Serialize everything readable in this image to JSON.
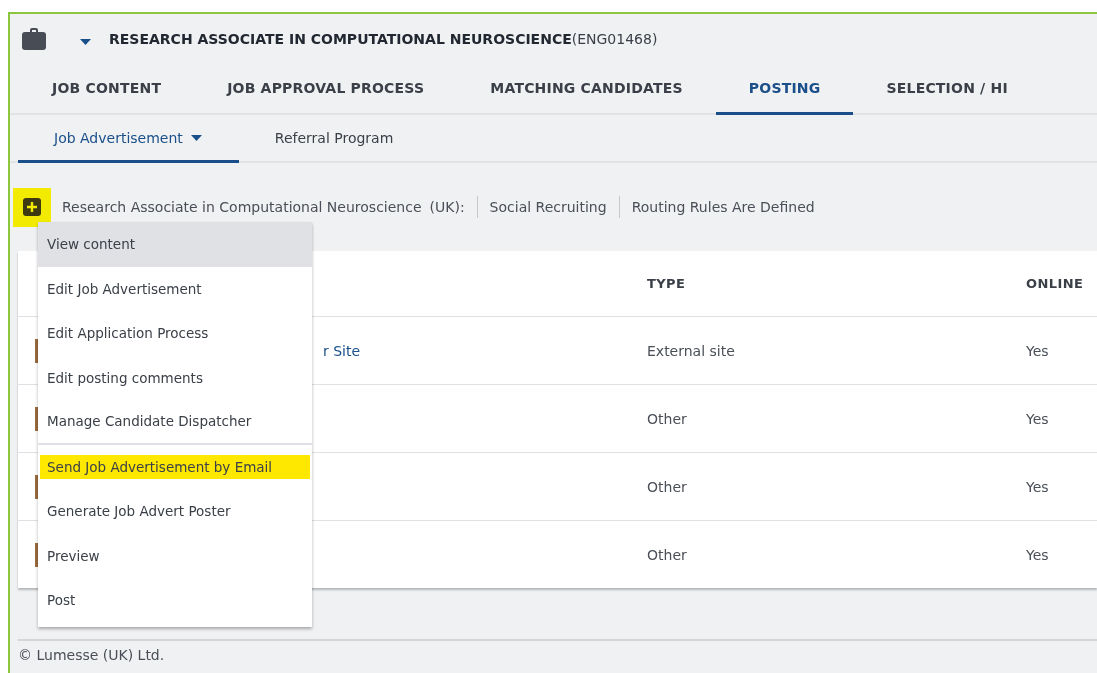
{
  "header": {
    "title": "RESEARCH ASSOCIATE IN COMPUTATIONAL NEUROSCIENCE",
    "code": "(ENG01468)"
  },
  "tabs": [
    {
      "label": "JOB CONTENT",
      "selected": false
    },
    {
      "label": "JOB APPROVAL PROCESS",
      "selected": false
    },
    {
      "label": "MATCHING CANDIDATES",
      "selected": false
    },
    {
      "label": "POSTING",
      "selected": true
    },
    {
      "label": "SELECTION / HI",
      "selected": false
    }
  ],
  "subtabs": [
    {
      "label": "Job Advertisement",
      "selected": true,
      "dropdown": true
    },
    {
      "label": "Referral Program",
      "selected": false,
      "dropdown": false
    }
  ],
  "info_bar": {
    "add_highlighted": true,
    "title": "Research Associate in Computational Neuroscience",
    "country": "(UK):",
    "items": [
      "Social Recruiting",
      "Routing Rules Are Defined"
    ]
  },
  "table": {
    "columns": [
      "TYPE",
      "ONLINE"
    ],
    "rows": [
      {
        "column_1": "r Site",
        "type": "External site",
        "online": "Yes"
      },
      {
        "type": "Other",
        "online": "Yes"
      },
      {
        "type": "Other",
        "online": "Yes"
      },
      {
        "type": "Other",
        "online": "Yes"
      }
    ]
  },
  "menu": [
    {
      "label": "View content",
      "hovered": true,
      "highlighted": false,
      "divider_after": false
    },
    {
      "label": "Edit Job Advertisement",
      "hovered": false,
      "highlighted": false,
      "divider_after": false
    },
    {
      "label": "Edit Application Process",
      "hovered": false,
      "highlighted": false,
      "divider_after": false
    },
    {
      "label": "Edit posting comments",
      "hovered": false,
      "highlighted": false,
      "divider_after": false
    },
    {
      "label": "Manage Candidate Dispatcher",
      "hovered": false,
      "highlighted": false,
      "divider_after": true
    },
    {
      "label": "Send Job Advertisement by Email",
      "hovered": false,
      "highlighted": true,
      "divider_after": false
    },
    {
      "label": "Generate Job Advert Poster",
      "hovered": false,
      "highlighted": false,
      "divider_after": false
    },
    {
      "label": "Preview",
      "hovered": false,
      "highlighted": false,
      "divider_after": false
    },
    {
      "label": "Post",
      "hovered": false,
      "highlighted": false,
      "divider_after": false
    }
  ],
  "footer": "© Lumesse (UK) Ltd."
}
